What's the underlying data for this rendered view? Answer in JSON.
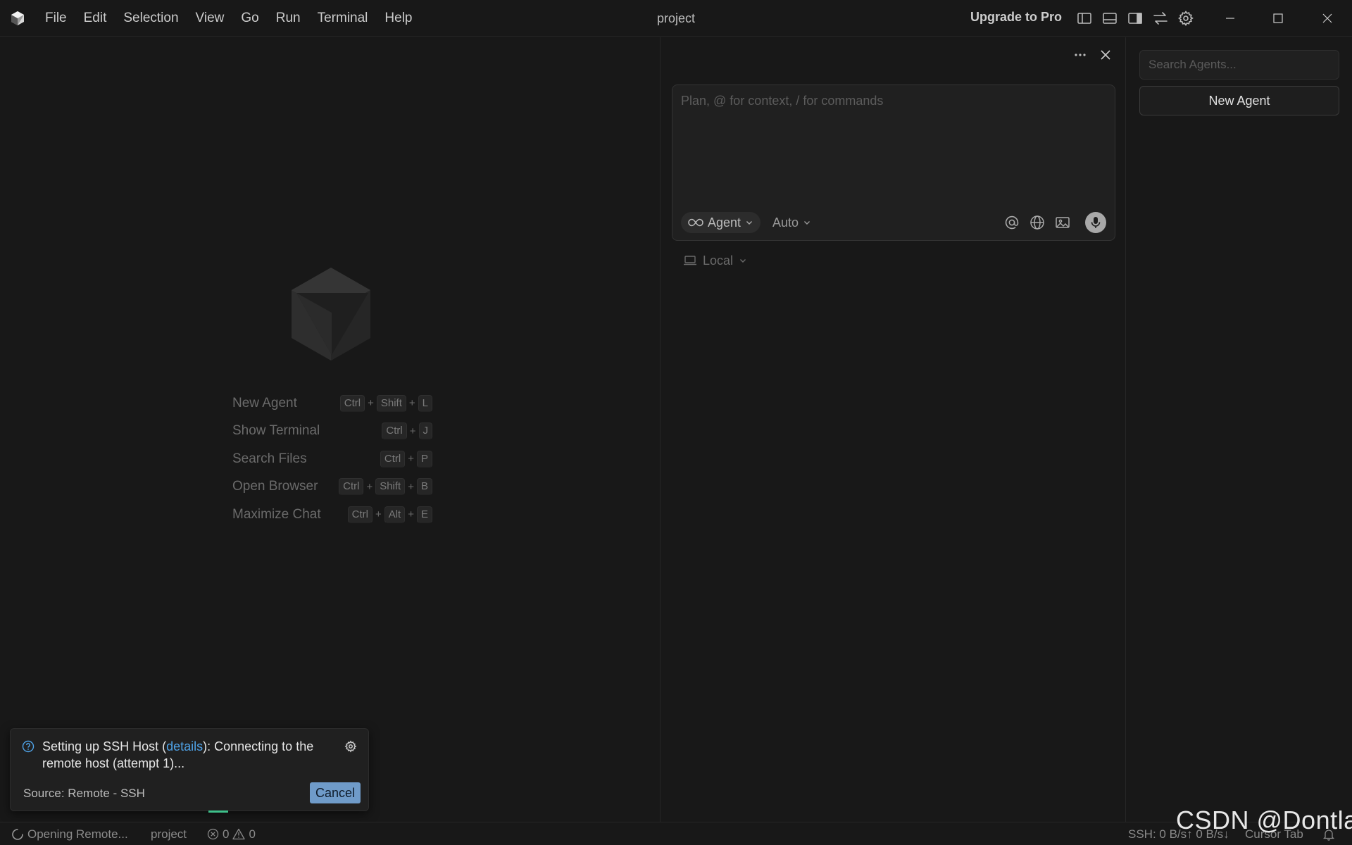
{
  "titlebar": {
    "menu": [
      "File",
      "Edit",
      "Selection",
      "View",
      "Go",
      "Run",
      "Terminal",
      "Help"
    ],
    "title": "project",
    "upgrade": "Upgrade to Pro",
    "icons": [
      "toggle-primary-sidebar-icon",
      "toggle-panel-icon",
      "toggle-secondary-sidebar-icon",
      "swap-icon",
      "settings-gear-icon"
    ],
    "window_controls": [
      "minimize-icon",
      "maximize-icon",
      "close-icon"
    ]
  },
  "editor": {
    "shortcuts": [
      {
        "label": "New Agent",
        "keys": [
          "Ctrl",
          "Shift",
          "L"
        ]
      },
      {
        "label": "Show Terminal",
        "keys": [
          "Ctrl",
          "J"
        ]
      },
      {
        "label": "Search Files",
        "keys": [
          "Ctrl",
          "P"
        ]
      },
      {
        "label": "Open Browser",
        "keys": [
          "Ctrl",
          "Shift",
          "B"
        ]
      },
      {
        "label": "Maximize Chat",
        "keys": [
          "Ctrl",
          "Alt",
          "E"
        ]
      }
    ],
    "key_joiner": "+"
  },
  "chat": {
    "placeholder": "Plan, @ for context, / for commands",
    "mode": "Agent",
    "model": "Auto",
    "environment": "Local",
    "composer_icons": [
      "mention-icon",
      "globe-icon",
      "image-icon",
      "microphone-icon"
    ]
  },
  "agents": {
    "search_placeholder": "Search Agents...",
    "new_agent": "New Agent"
  },
  "toast": {
    "msg_prefix": "Setting up SSH Host (",
    "msg_link": "details",
    "msg_suffix": "): Connecting to the remote host (attempt 1)...",
    "source": "Source: Remote - SSH",
    "cancel": "Cancel"
  },
  "statusbar": {
    "remote": "Opening Remote...",
    "workspace": "project",
    "errors": "0",
    "warnings": "0",
    "ssh": "SSH: 0 B/s↑ 0 B/s↓",
    "cursor_tab": "Cursor Tab"
  },
  "watermark": "CSDN @Dontla",
  "colors": {
    "background": "#181818",
    "accent_link": "#4fa3e8",
    "cancel_button": "#6f9bc9",
    "progress": "#3ec08a"
  }
}
